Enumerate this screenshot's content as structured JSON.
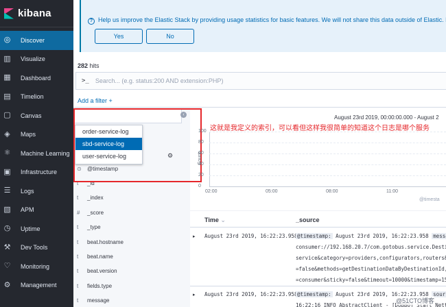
{
  "sidebar": {
    "brand": "kibana",
    "items": [
      {
        "label": "Discover",
        "icon": "compass-icon",
        "active": true
      },
      {
        "label": "Visualize",
        "icon": "bar-chart-icon"
      },
      {
        "label": "Dashboard",
        "icon": "dashboard-icon"
      },
      {
        "label": "Timelion",
        "icon": "timelion-icon"
      },
      {
        "label": "Canvas",
        "icon": "canvas-icon"
      },
      {
        "label": "Maps",
        "icon": "maps-icon"
      },
      {
        "label": "Machine Learning",
        "icon": "machine-learning-icon"
      },
      {
        "label": "Infrastructure",
        "icon": "infrastructure-icon"
      },
      {
        "label": "Logs",
        "icon": "logs-icon"
      },
      {
        "label": "APM",
        "icon": "apm-icon"
      },
      {
        "label": "Uptime",
        "icon": "uptime-icon"
      },
      {
        "label": "Dev Tools",
        "icon": "wrench-icon"
      },
      {
        "label": "Monitoring",
        "icon": "heartbeat-icon"
      },
      {
        "label": "Management",
        "icon": "gear-icon"
      }
    ]
  },
  "banner": {
    "text": "Help us improve the Elastic Stack by providing usage statistics for basic features. We will not share this data outside of Elastic. Rea",
    "yes_label": "Yes",
    "no_label": "No"
  },
  "hits": {
    "count": "282",
    "label": "hits"
  },
  "search": {
    "prompt": ">_",
    "placeholder": "Search... (e.g. status:200 AND extension:PHP)"
  },
  "filter": {
    "label": "Add a filter +"
  },
  "index_dropdown": {
    "options": [
      "order-service-log",
      "sbd-service-log",
      "user-service-log"
    ],
    "selected": "sbd-service-log"
  },
  "fields": [
    {
      "type": "⊙",
      "name": "@timestamp"
    },
    {
      "type": "t",
      "name": "_id"
    },
    {
      "type": "t",
      "name": "_index"
    },
    {
      "type": "#",
      "name": "_score"
    },
    {
      "type": "t",
      "name": "_type"
    },
    {
      "type": "t",
      "name": "beat.hostname"
    },
    {
      "type": "t",
      "name": "beat.name"
    },
    {
      "type": "t",
      "name": "beat.version"
    },
    {
      "type": "t",
      "name": "fields.type"
    },
    {
      "type": "t",
      "name": "message"
    }
  ],
  "annotation": "这就是我定义的索引，可以看但这样我很简单的知道这个日志是哪个服务",
  "date_range": "August 23rd 2019, 00:00:00.000 - August 2",
  "chart": {
    "y_title": "Count",
    "y_ticks": [
      "100",
      "80",
      "60",
      "40",
      "20",
      "0"
    ],
    "x_ticks": [
      "02:00",
      "05:00",
      "08:00",
      "11:00"
    ],
    "x_label": "@timesta"
  },
  "table": {
    "col_time": "Time",
    "col_source": "_source",
    "rows": [
      {
        "time": "August 23rd 2019, 16:22:23.958",
        "lines": [
          [
            "@timestamp:",
            " August 23rd 2019, 16:22:23.958 ",
            "message:"
          ],
          [
            "",
            "consumer://192.168.20.7/com.gotobus.service.Destinati",
            ""
          ],
          [
            "",
            "service&category=providers,configurators,routers&check",
            ""
          ],
          [
            "",
            "=false&methods=getDestinationDataByDestinationId,getDe",
            ""
          ],
          [
            "",
            "=consumer&sticky=false&timeout=10000&timestamp=156654",
            ""
          ]
        ]
      },
      {
        "time": "August 23rd 2019, 16:22:23.958",
        "lines": [
          [
            "@timestamp:",
            " August 23rd 2019, 16:22:23.958 ",
            "source:"
          ],
          [
            "",
            "16:22:16 INFO AbstractClient - [DUBBO] Start NettyCli",
            ""
          ]
        ]
      }
    ]
  },
  "watermark": "@51CTO博客"
}
